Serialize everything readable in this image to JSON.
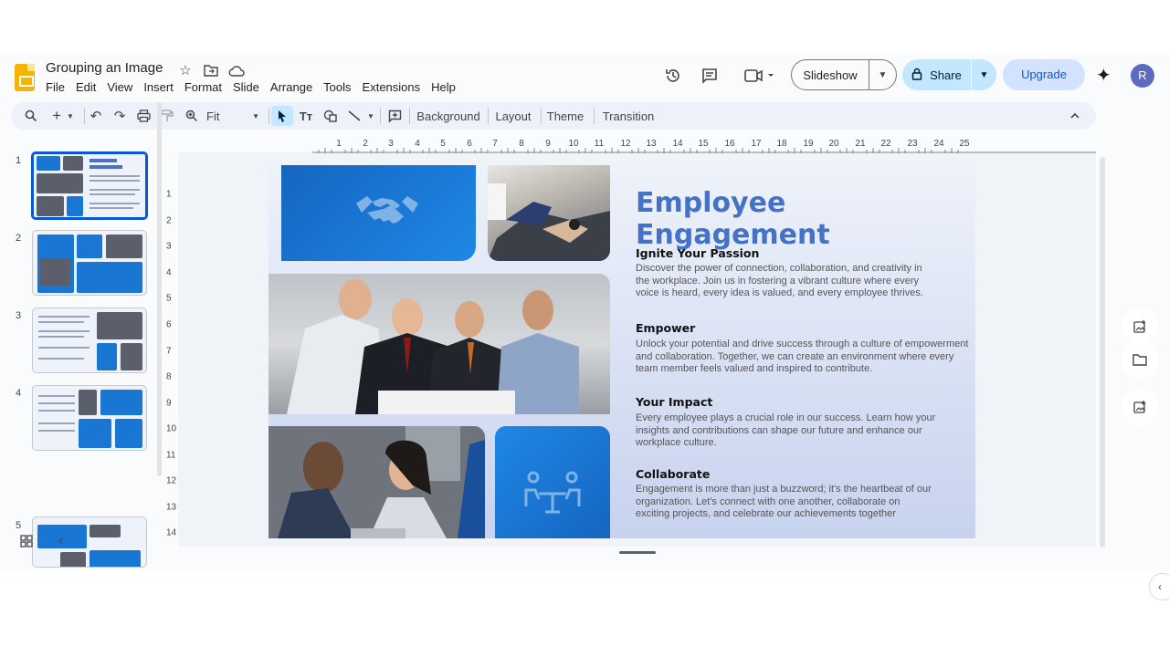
{
  "doc": {
    "title": "Grouping an Image"
  },
  "menu": [
    "File",
    "Edit",
    "View",
    "Insert",
    "Format",
    "Slide",
    "Arrange",
    "Tools",
    "Extensions",
    "Help"
  ],
  "header": {
    "slideshow_label": "Slideshow",
    "share_label": "Share",
    "upgrade_label": "Upgrade",
    "avatar_letter": "R"
  },
  "toolbar": {
    "zoom_value": "Fit",
    "background_label": "Background",
    "layout_label": "Layout",
    "theme_label": "Theme",
    "transition_label": "Transition"
  },
  "filmstrip": {
    "slide_numbers": [
      "1",
      "2",
      "3",
      "4",
      "5"
    ]
  },
  "rulers": {
    "horizontal": [
      "1",
      "2",
      "3",
      "4",
      "5",
      "6",
      "7",
      "8",
      "9",
      "10",
      "11",
      "12",
      "13",
      "14",
      "15",
      "16",
      "17",
      "18",
      "19",
      "20",
      "21",
      "22",
      "23",
      "24",
      "25"
    ],
    "vertical": [
      "1",
      "2",
      "3",
      "4",
      "5",
      "6",
      "7",
      "8",
      "9",
      "10",
      "11",
      "12",
      "13",
      "14"
    ]
  },
  "slide": {
    "title": "Employee Engagement",
    "sections": [
      {
        "heading": "Ignite Your Passion",
        "body": "Discover the power of connection, collaboration, and creativity in the workplace. Join us in fostering a vibrant culture where every voice is heard, every idea is valued, and every employee thrives."
      },
      {
        "heading": "Empower",
        "body": "Unlock your potential and drive success through a culture of empowerment and collaboration. Together, we can create an environment where every team member feels valued and inspired to contribute."
      },
      {
        "heading": "Your Impact",
        "body": "Every employee plays a crucial role in our success. Learn how your insights and contributions can shape our future and enhance our workplace culture."
      },
      {
        "heading": "Collaborate",
        "body": "Engagement is more than just a buzzword; it's the heartbeat of our organization. Let's connect with one another, collaborate on exciting projects, and celebrate our achievements together"
      }
    ]
  },
  "colors": {
    "accent": "#0b57d0",
    "slide_blue": "#1976d2",
    "title_blue": "#4472c4",
    "share_bg": "#c2e7ff",
    "logo_yellow": "#f4b400"
  },
  "icons": [
    "star-icon",
    "move-to-folder-icon",
    "cloud-status-icon",
    "history-icon",
    "comment-icon",
    "video-call-icon",
    "lock-icon",
    "gemini-icon",
    "handshake-icon",
    "meeting-table-icon"
  ]
}
